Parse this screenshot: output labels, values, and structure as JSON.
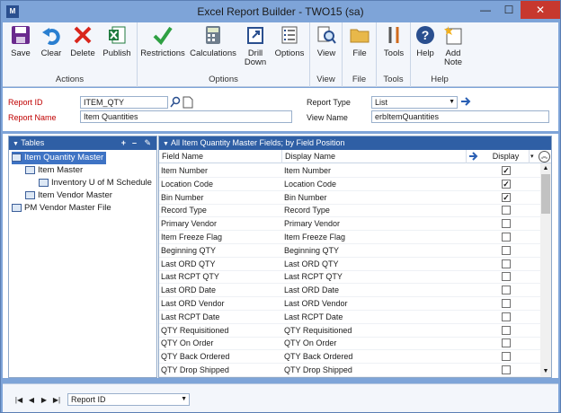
{
  "window": {
    "title": "Excel Report Builder  -  TWO15 (sa)",
    "app_icon": "M",
    "minimize": "—",
    "maximize": "☐",
    "close": "✕"
  },
  "ribbon": {
    "groups": [
      {
        "label": "Actions",
        "buttons": [
          "Save",
          "Clear",
          "Delete",
          "Publish"
        ]
      },
      {
        "label": "Options",
        "buttons": [
          "Restrictions",
          "Calculations",
          "Drill\nDown",
          "Options"
        ]
      },
      {
        "label": "View",
        "buttons": [
          "View"
        ]
      },
      {
        "label": "File",
        "buttons": [
          "File"
        ]
      },
      {
        "label": "Tools",
        "buttons": [
          "Tools"
        ]
      },
      {
        "label": "Help",
        "buttons": [
          "Help",
          "Add\nNote"
        ]
      }
    ]
  },
  "form": {
    "report_id_label": "Report ID",
    "report_id_value": "ITEM_QTY",
    "report_name_label": "Report Name",
    "report_name_value": "Item Quantities",
    "report_type_label": "Report Type",
    "report_type_value": "List",
    "view_name_label": "View Name",
    "view_name_value": "erbItemQuantities"
  },
  "tables_pane": {
    "header": "Tables",
    "items": [
      {
        "label": "Item Quantity Master",
        "level": 0,
        "selected": true
      },
      {
        "label": "Item Master",
        "level": 1
      },
      {
        "label": "Inventory U of M Schedule",
        "level": 2
      },
      {
        "label": "Item Vendor Master",
        "level": 1
      },
      {
        "label": "PM Vendor Master File",
        "level": 0
      }
    ]
  },
  "fields_pane": {
    "header": "All Item Quantity Master Fields; by Field Position",
    "columns": {
      "field_name": "Field Name",
      "display_name": "Display Name",
      "display": "Display"
    },
    "rows": [
      {
        "field": "Item Number",
        "display_name": "Item Number",
        "checked": true
      },
      {
        "field": "Location Code",
        "display_name": "Location Code",
        "checked": true
      },
      {
        "field": "Bin Number",
        "display_name": "Bin Number",
        "checked": true
      },
      {
        "field": "Record Type",
        "display_name": "Record Type",
        "checked": false
      },
      {
        "field": "Primary Vendor",
        "display_name": "Primary Vendor",
        "checked": false
      },
      {
        "field": "Item Freeze Flag",
        "display_name": "Item Freeze Flag",
        "checked": false
      },
      {
        "field": "Beginning QTY",
        "display_name": "Beginning QTY",
        "checked": false
      },
      {
        "field": "Last ORD QTY",
        "display_name": "Last ORD QTY",
        "checked": false
      },
      {
        "field": "Last RCPT QTY",
        "display_name": "Last RCPT QTY",
        "checked": false
      },
      {
        "field": "Last ORD Date",
        "display_name": "Last ORD Date",
        "checked": false
      },
      {
        "field": "Last ORD Vendor",
        "display_name": "Last ORD Vendor",
        "checked": false
      },
      {
        "field": "Last RCPT Date",
        "display_name": "Last RCPT Date",
        "checked": false
      },
      {
        "field": "QTY Requisitioned",
        "display_name": "QTY Requisitioned",
        "checked": false
      },
      {
        "field": "QTY On Order",
        "display_name": "QTY On Order",
        "checked": false
      },
      {
        "field": "QTY Back Ordered",
        "display_name": "QTY Back Ordered",
        "checked": false
      },
      {
        "field": "QTY Drop Shipped",
        "display_name": "QTY Drop Shipped",
        "checked": false
      }
    ]
  },
  "statusbar": {
    "sort_value": "Report ID"
  },
  "colors": {
    "accent": "#2f5fa5",
    "frame": "#7ea4d8",
    "required": "#c00000"
  }
}
